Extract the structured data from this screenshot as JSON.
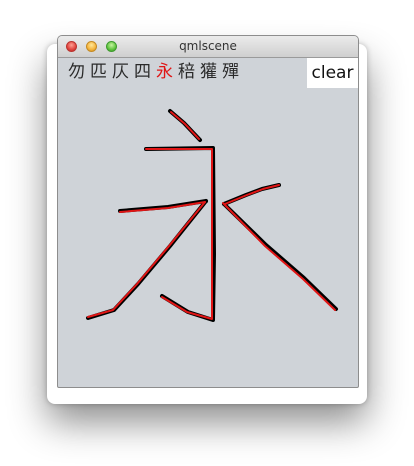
{
  "window": {
    "title": "qmlscene"
  },
  "candidates": {
    "items": [
      "勿",
      "匹",
      "仄",
      "四",
      "永",
      "稖",
      "獾",
      "殫"
    ],
    "selected_index": 4,
    "selected_color": "#e01515"
  },
  "clear_button": {
    "label": "clear"
  },
  "strokes": {
    "ink_color": "#000000",
    "highlight_color": "#e01515"
  }
}
